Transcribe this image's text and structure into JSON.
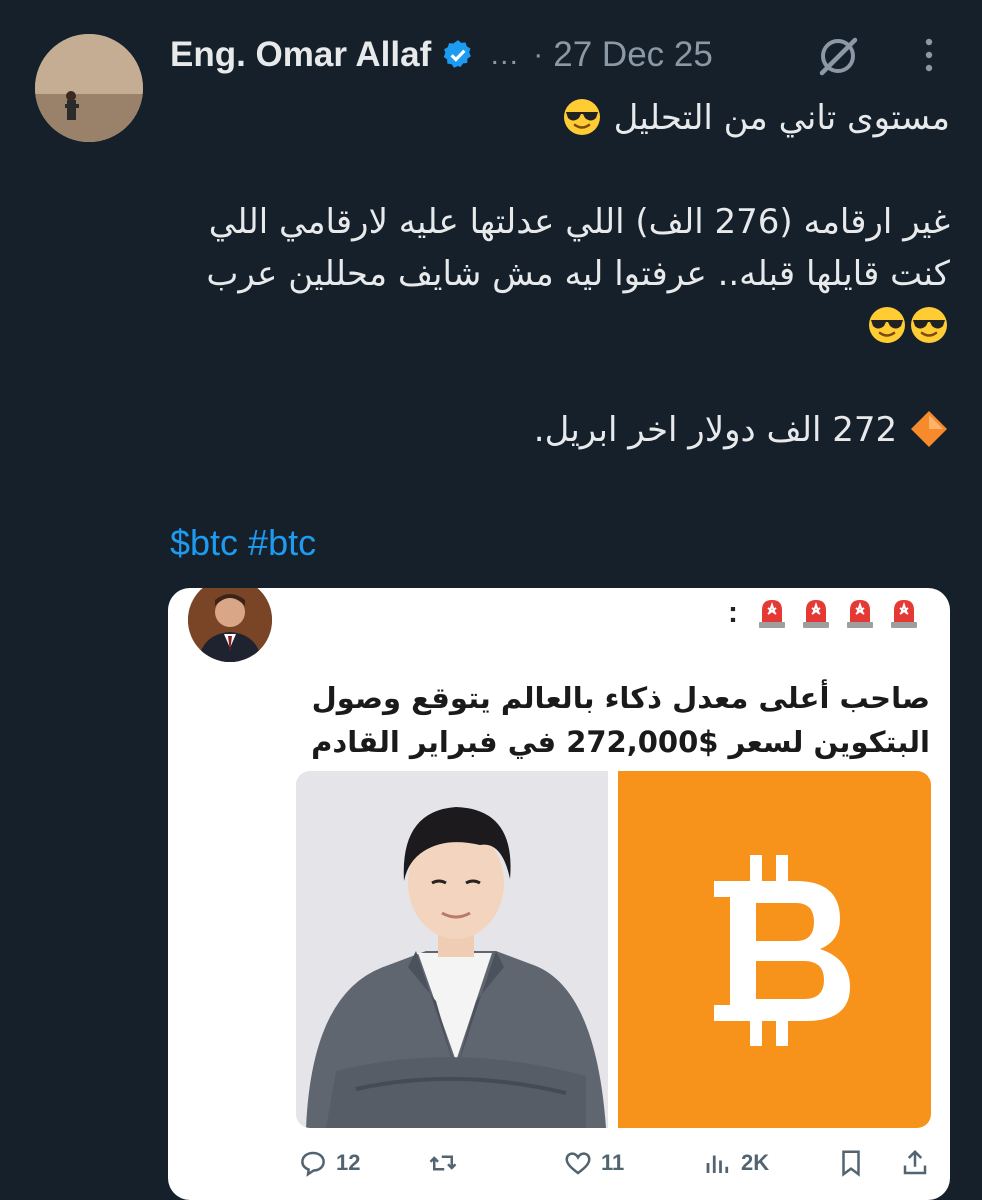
{
  "author": {
    "name": "Eng. Omar Allaf",
    "truncation": "…",
    "separator": "·",
    "date": "27 Dec 25"
  },
  "tweet": {
    "line1": "مستوى تاني من التحليل",
    "line2": "غير ارقامه (276 الف) اللي عدلتها عليه لارقامي اللي",
    "line3": "كنت قايلها قبله.. عرفتوا ليه مش شايف محللين عرب",
    "line4": "272 الف دولار اخر ابريل.",
    "hashtag1": "$btc",
    "hashtag2": "#btc"
  },
  "card": {
    "colon": ":",
    "title_line1": "صاحب أعلى معدل ذكاء بالعالم يتوقع وصول",
    "title_line2": "البتكوين لسعر $272,000 في فبراير القادم"
  },
  "actions": {
    "replies": "12",
    "likes": "11",
    "views": "2K"
  },
  "colors": {
    "background": "#15202b",
    "link": "#1d9bf0",
    "verified": "#1d9bf0",
    "bitcoin": "#f7931a",
    "muted": "#8b98a5"
  },
  "icons": [
    "verified-icon",
    "grok-icon",
    "more-icon",
    "sunglasses-emoji",
    "orange-diamond-emoji",
    "siren-emoji",
    "bitcoin-logo",
    "reply-icon",
    "retweet-icon",
    "like-icon",
    "views-icon",
    "bookmark-icon",
    "share-icon"
  ]
}
